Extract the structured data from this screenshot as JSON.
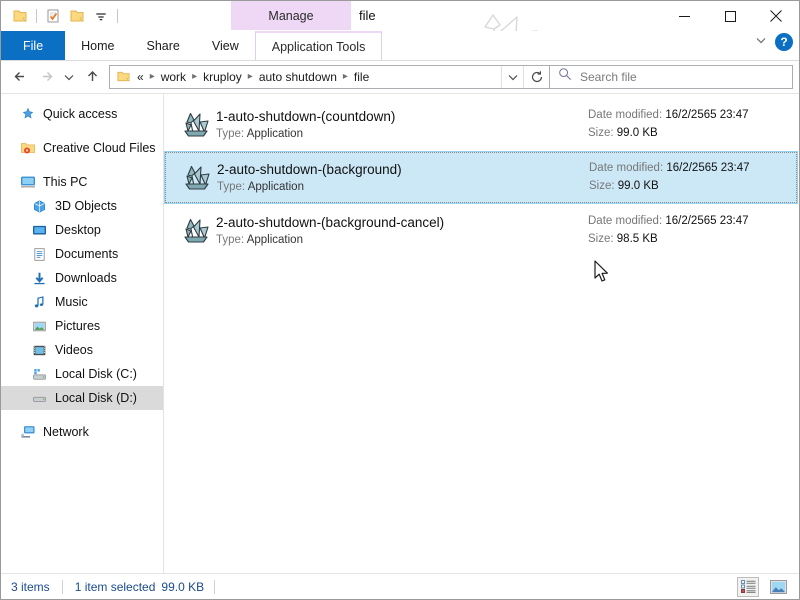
{
  "window": {
    "title": "file",
    "watermark_text": "www.KRUPLOY.com",
    "minimize_label": "Minimize",
    "maximize_label": "Maximize",
    "close_label": "Close"
  },
  "quick_access_toolbar": {
    "items": [
      {
        "name": "properties-folder-icon",
        "label": "Properties"
      },
      {
        "name": "properties-checkmark-icon",
        "label": "Properties"
      },
      {
        "name": "new-folder-icon",
        "label": "New folder"
      },
      {
        "name": "customize-dropdown-icon",
        "label": "Customize Quick Access Toolbar"
      }
    ]
  },
  "ribbon": {
    "contextual_header": "Manage",
    "tabs": [
      {
        "label": "File",
        "active_file": true
      },
      {
        "label": "Home",
        "active_file": false
      },
      {
        "label": "Share",
        "active_file": false
      },
      {
        "label": "View",
        "active_file": false
      }
    ],
    "contextual_tab": "Application Tools",
    "collapse_label": "Minimize the Ribbon",
    "help_label": "?"
  },
  "navigation": {
    "back_label": "Back",
    "forward_label": "Forward",
    "recent_label": "Recent locations",
    "up_label": "Up one level",
    "refresh_label": "Refresh",
    "address_dropdown_label": "Previous locations"
  },
  "address": {
    "overflow": "«",
    "crumbs": [
      {
        "label": "work"
      },
      {
        "label": "kruploy"
      },
      {
        "label": "auto shutdown"
      },
      {
        "label": "file"
      }
    ]
  },
  "search": {
    "placeholder": "Search file",
    "value": ""
  },
  "sidebar": {
    "items": [
      {
        "label": "Quick access",
        "icon": "pin-star-icon",
        "indent": false,
        "selected": false,
        "gap_before": false
      },
      {
        "label": "Creative Cloud Files",
        "icon": "creative-cloud-folder-icon",
        "indent": false,
        "selected": false,
        "gap_before": true
      },
      {
        "label": "This PC",
        "icon": "this-pc-icon",
        "indent": false,
        "selected": false,
        "gap_before": true
      },
      {
        "label": "3D Objects",
        "icon": "3d-objects-icon",
        "indent": true,
        "selected": false,
        "gap_before": false
      },
      {
        "label": "Desktop",
        "icon": "desktop-icon",
        "indent": true,
        "selected": false,
        "gap_before": false
      },
      {
        "label": "Documents",
        "icon": "documents-icon",
        "indent": true,
        "selected": false,
        "gap_before": false
      },
      {
        "label": "Downloads",
        "icon": "downloads-icon",
        "indent": true,
        "selected": false,
        "gap_before": false
      },
      {
        "label": "Music",
        "icon": "music-icon",
        "indent": true,
        "selected": false,
        "gap_before": false
      },
      {
        "label": "Pictures",
        "icon": "pictures-icon",
        "indent": true,
        "selected": false,
        "gap_before": false
      },
      {
        "label": "Videos",
        "icon": "videos-icon",
        "indent": true,
        "selected": false,
        "gap_before": false
      },
      {
        "label": "Local Disk (C:)",
        "icon": "local-disk-c-icon",
        "indent": true,
        "selected": false,
        "gap_before": false
      },
      {
        "label": "Local Disk (D:)",
        "icon": "local-disk-d-icon",
        "indent": true,
        "selected": true,
        "gap_before": false
      },
      {
        "label": "Network",
        "icon": "network-icon",
        "indent": false,
        "selected": false,
        "gap_before": true
      }
    ]
  },
  "file_list": {
    "labels": {
      "type": "Type:",
      "date_modified": "Date modified:",
      "size": "Size:"
    },
    "rows": [
      {
        "name": "1-auto-shutdown-(countdown)",
        "type": "Application",
        "date_modified": "16/2/2565 23:47",
        "size": "99.0 KB",
        "selected": false,
        "icon": "autohotkey-swan-icon"
      },
      {
        "name": "2-auto-shutdown-(background)",
        "type": "Application",
        "date_modified": "16/2/2565 23:47",
        "size": "99.0 KB",
        "selected": true,
        "icon": "autohotkey-swan-icon"
      },
      {
        "name": "2-auto-shutdown-(background-cancel)",
        "type": "Application",
        "date_modified": "16/2/2565 23:47",
        "size": "98.5 KB",
        "selected": false,
        "icon": "autohotkey-swan-icon"
      }
    ]
  },
  "statusbar": {
    "item_count": "3 items",
    "selection_info": "1 item selected",
    "selection_size": "99.0 KB",
    "details_view_label": "Details view",
    "large_icons_view_label": "Large icons view"
  },
  "colors": {
    "accent_blue": "#0b6fc4",
    "contextual_purple": "#efd8f5",
    "selection_blue": "#cce8f7",
    "selection_border": "#99d1f2",
    "sidebar_selected": "#dadada",
    "status_text": "#1b4b8f",
    "watermark_gray": "#d3d3d3"
  }
}
